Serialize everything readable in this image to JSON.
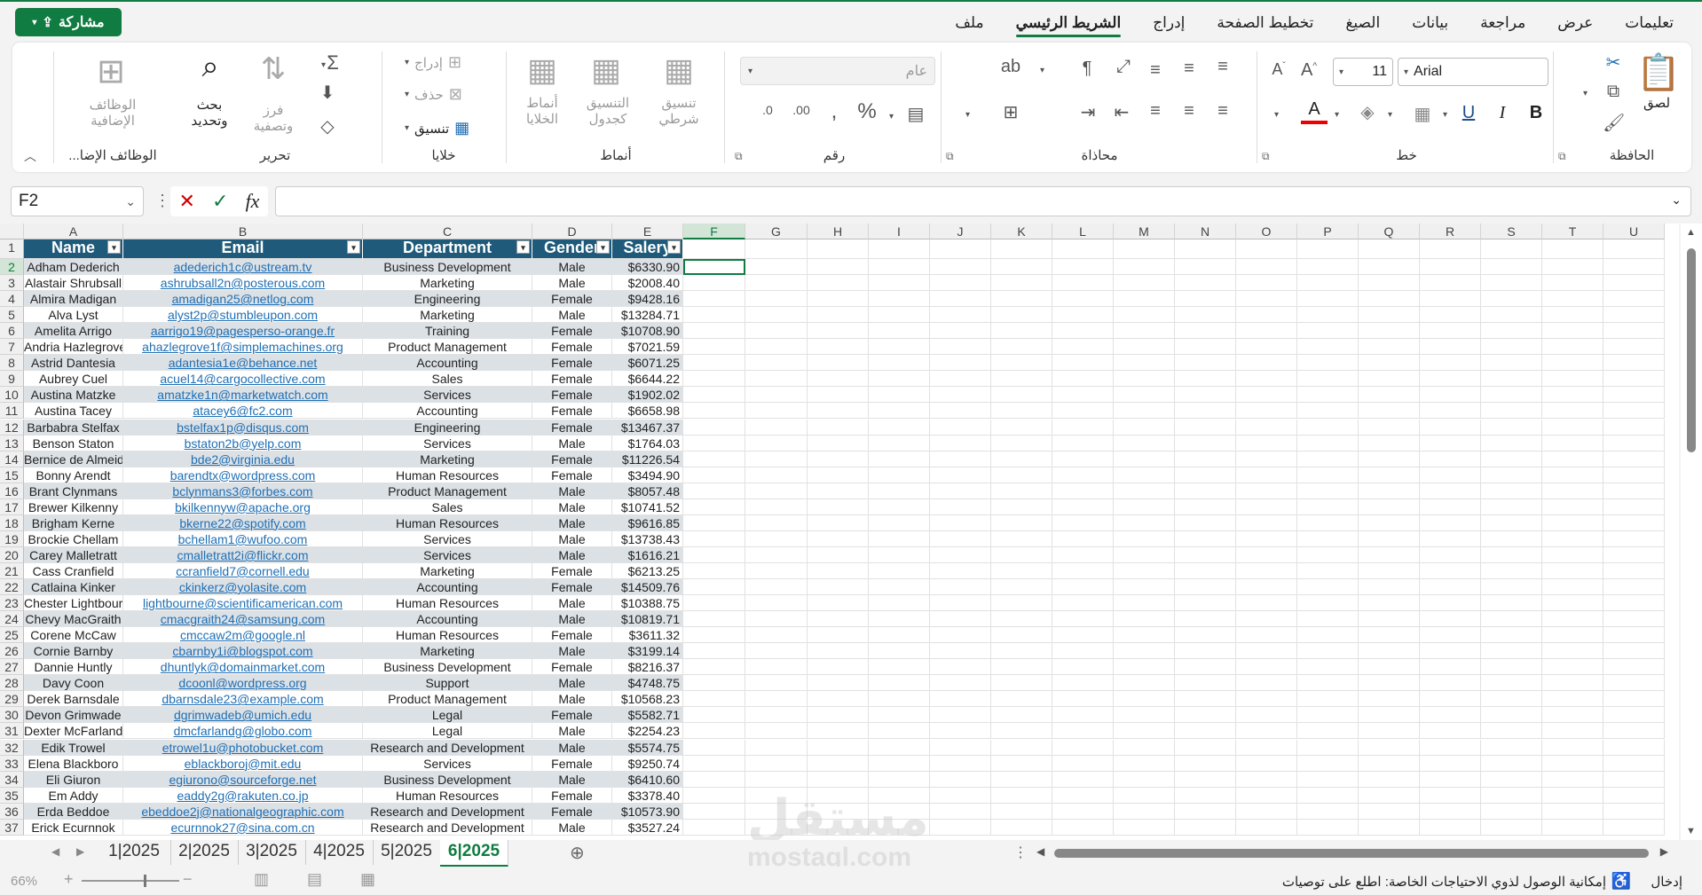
{
  "share_label": "مشاركة",
  "tabs": [
    "ملف",
    "الشريط الرئيسي",
    "إدراج",
    "تخطيط الصفحة",
    "الصيغ",
    "بيانات",
    "مراجعة",
    "عرض",
    "تعليمات"
  ],
  "active_tab": "الشريط الرئيسي",
  "ribbon": {
    "clipboard": {
      "label": "الحافظة",
      "paste": "لصق"
    },
    "font": {
      "label": "خط",
      "name": "Arial",
      "size": "11"
    },
    "alignment": {
      "label": "محاذاة"
    },
    "number": {
      "label": "رقم",
      "format": "عام"
    },
    "styles": {
      "label": "أنماط",
      "conditional": "تنسيق شرطي",
      "table": "التنسيق كجدول",
      "cell": "أنماط الخلايا"
    },
    "cells": {
      "label": "خلايا",
      "insert": "إدراج",
      "delete": "حذف",
      "format": "تنسيق"
    },
    "editing": {
      "label": "تحرير",
      "sort": "فرز وتصفية",
      "find": "بحث وتحديد"
    },
    "addins": {
      "label": "الوظائف الإضا...",
      "button": "الوظائف الإضافية"
    }
  },
  "namebox": "F2",
  "columns": [
    "A",
    "B",
    "C",
    "D",
    "E",
    "F",
    "G",
    "H",
    "I",
    "J",
    "K",
    "L",
    "M",
    "N",
    "O",
    "P",
    "Q",
    "R",
    "S",
    "T",
    "U"
  ],
  "selected_column": "F",
  "table_headers": [
    "Name",
    "Email",
    "Department",
    "Gender",
    "Salery"
  ],
  "rows": [
    [
      "Adham Dederich",
      "adederich1c@ustream.tv",
      "Business Development",
      "Male",
      "$6330.90"
    ],
    [
      "Alastair Shrubsall",
      "ashrubsall2n@posterous.com",
      "Marketing",
      "Male",
      "$2008.40"
    ],
    [
      "Almira Madigan",
      "amadigan25@netlog.com",
      "Engineering",
      "Female",
      "$9428.16"
    ],
    [
      "Alva Lyst",
      "alyst2p@stumbleupon.com",
      "Marketing",
      "Male",
      "$13284.71"
    ],
    [
      "Amelita Arrigo",
      "aarrigo19@pagesperso-orange.fr",
      "Training",
      "Female",
      "$10708.90"
    ],
    [
      "Andria Hazlegrove",
      "ahazlegrove1f@simplemachines.org",
      "Product Management",
      "Female",
      "$7021.59"
    ],
    [
      "Astrid Dantesia",
      "adantesia1e@behance.net",
      "Accounting",
      "Female",
      "$6071.25"
    ],
    [
      "Aubrey Cuel",
      "acuel14@cargocollective.com",
      "Sales",
      "Female",
      "$6644.22"
    ],
    [
      "Austina Matzke",
      "amatzke1n@marketwatch.com",
      "Services",
      "Female",
      "$1902.02"
    ],
    [
      "Austina Tacey",
      "atacey6@fc2.com",
      "Accounting",
      "Female",
      "$6658.98"
    ],
    [
      "Barbabra Stelfax",
      "bstelfax1p@disqus.com",
      "Engineering",
      "Female",
      "$13467.37"
    ],
    [
      "Benson Staton",
      "bstaton2b@yelp.com",
      "Services",
      "Male",
      "$1764.03"
    ],
    [
      "Bernice de Almeida",
      "bde2@virginia.edu",
      "Marketing",
      "Female",
      "$11226.54"
    ],
    [
      "Bonny Arendt",
      "barendtx@wordpress.com",
      "Human Resources",
      "Female",
      "$3494.90"
    ],
    [
      "Brant Clynmans",
      "bclynmans3@forbes.com",
      "Product Management",
      "Male",
      "$8057.48"
    ],
    [
      "Brewer Kilkenny",
      "bkilkennyw@apache.org",
      "Sales",
      "Male",
      "$10741.52"
    ],
    [
      "Brigham Kerne",
      "bkerne22@spotify.com",
      "Human Resources",
      "Male",
      "$9616.85"
    ],
    [
      "Brockie Chellam",
      "bchellam1@wufoo.com",
      "Services",
      "Male",
      "$13738.43"
    ],
    [
      "Carey Malletratt",
      "cmalletratt2i@flickr.com",
      "Services",
      "Male",
      "$1616.21"
    ],
    [
      "Cass Cranfield",
      "ccranfield7@cornell.edu",
      "Marketing",
      "Female",
      "$6213.25"
    ],
    [
      "Catlaina Kinker",
      "ckinkerz@yolasite.com",
      "Accounting",
      "Female",
      "$14509.76"
    ],
    [
      "Chester Lightbourne",
      "lightbourne@scientificamerican.com",
      "Human Resources",
      "Male",
      "$10388.75"
    ],
    [
      "Chevy MacGraith",
      "cmacgraith24@samsung.com",
      "Accounting",
      "Male",
      "$10819.71"
    ],
    [
      "Corene McCaw",
      "cmccaw2m@google.nl",
      "Human Resources",
      "Female",
      "$3611.32"
    ],
    [
      "Cornie Barnby",
      "cbarnby1i@blogspot.com",
      "Marketing",
      "Male",
      "$3199.14"
    ],
    [
      "Dannie Huntly",
      "dhuntlyk@domainmarket.com",
      "Business Development",
      "Female",
      "$8216.37"
    ],
    [
      "Davy Coon",
      "dcoonl@wordpress.org",
      "Support",
      "Male",
      "$4748.75"
    ],
    [
      "Derek Barnsdale",
      "dbarnsdale23@example.com",
      "Product Management",
      "Male",
      "$10568.23"
    ],
    [
      "Devon Grimwade",
      "dgrimwadeb@umich.edu",
      "Legal",
      "Female",
      "$5582.71"
    ],
    [
      "Dexter McFarland",
      "dmcfarlandg@globo.com",
      "Legal",
      "Male",
      "$2254.23"
    ],
    [
      "Edik Trowel",
      "etrowel1u@photobucket.com",
      "Research and Development",
      "Male",
      "$5574.75"
    ],
    [
      "Elena Blackboro",
      "eblackboroj@mit.edu",
      "Services",
      "Female",
      "$9250.74"
    ],
    [
      "Eli Giuron",
      "egiurono@sourceforge.net",
      "Business Development",
      "Male",
      "$6410.60"
    ],
    [
      "Em Addy",
      "eaddy2g@rakuten.co.jp",
      "Human Resources",
      "Female",
      "$3378.40"
    ],
    [
      "Erda Beddoe",
      "ebeddoe2j@nationalgeographic.com",
      "Research and Development",
      "Female",
      "$10573.90"
    ],
    [
      "Erick Ecurnnok",
      "ecurnnok27@sina.com.cn",
      "Research and Development",
      "Male",
      "$3527.24"
    ]
  ],
  "sheets": [
    "1|2025",
    "2|2025",
    "3|2025",
    "4|2025",
    "5|2025",
    "6|2025"
  ],
  "active_sheet": "6|2025",
  "status": {
    "mode": "إدخال",
    "accessibility": "إمكانية الوصول لذوي الاحتياجات الخاصة: اطلع على توصيات",
    "zoom": "66%"
  },
  "watermark": {
    "arabic": "مستقل",
    "latin": "mostaql.com"
  },
  "colors": {
    "accent": "#107c41",
    "table_header": "#1f5a7a",
    "band": "#dce1e6",
    "link": "#1f6fb4"
  }
}
